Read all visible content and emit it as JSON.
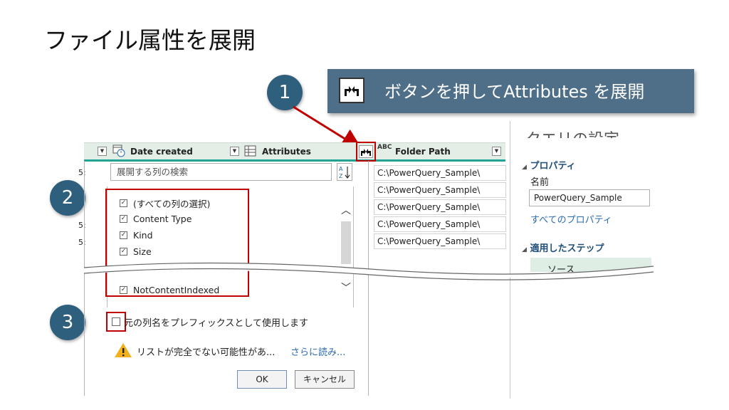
{
  "slide_title": "ファイル属性を展開",
  "callouts": {
    "step1": "1",
    "step2": "2",
    "step3": "3",
    "banner_text": "ボタンを押してAttributes を展開"
  },
  "table": {
    "col_date_created": "Date created",
    "col_attributes": "Attributes",
    "col_folder_path_type": "ABC",
    "col_folder_path": "Folder Path",
    "left_edge_rows": [
      "5:",
      "5:",
      "5:"
    ],
    "folder_path_rows": [
      "C:\\PowerQuery_Sample\\",
      "C:\\PowerQuery_Sample\\",
      "C:\\PowerQuery_Sample\\",
      "C:\\PowerQuery_Sample\\",
      "C:\\PowerQuery_Sample\\"
    ]
  },
  "expand_popup": {
    "search_placeholder": "展開する列の検索",
    "sort_label": "A Z",
    "columns": [
      {
        "label": "(すべての列の選択)",
        "checked": true
      },
      {
        "label": "Content Type",
        "checked": true
      },
      {
        "label": "Kind",
        "checked": true
      },
      {
        "label": "Size",
        "checked": true
      },
      {
        "label": "NotContentIndexed",
        "checked": true
      }
    ],
    "prefix_option": "元の列名をプレフィックスとして使用します",
    "prefix_checked": false,
    "warning_text": "リストが完全でない可能性があ...",
    "load_more_link": "さらに読み...",
    "ok_label": "OK",
    "cancel_label": "キャンセル"
  },
  "query_settings": {
    "pane_title_partial": "クエリの設定",
    "properties_header": "プロパティ",
    "name_label": "名前",
    "name_value": "PowerQuery_Sample",
    "all_properties_link": "すべてのプロパティ",
    "applied_steps_header": "適用したステップ",
    "first_step_partial": "ソース"
  },
  "colors": {
    "callout_circle": "#2e5f7c",
    "banner": "#4f6f89",
    "highlight_red": "#c00000",
    "header_green": "#e3efe6",
    "accent_teal": "#21a494"
  }
}
